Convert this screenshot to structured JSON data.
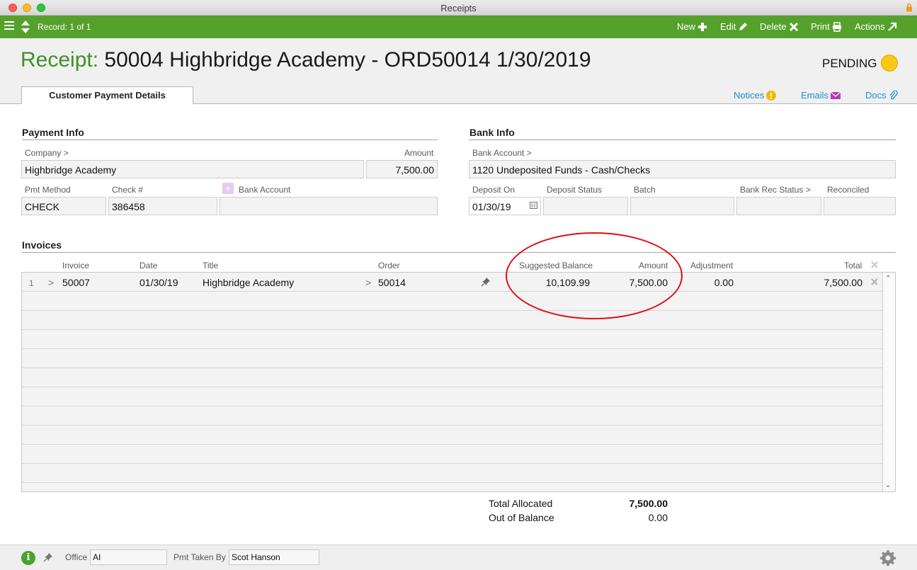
{
  "window": {
    "title": "Receipts"
  },
  "toolbar": {
    "record": "Record: 1 of 1",
    "new_label": "New",
    "edit_label": "Edit",
    "delete_label": "Delete",
    "print_label": "Print",
    "actions_label": "Actions"
  },
  "header": {
    "label": "Receipt:",
    "title": "50004 Highbridge Academy - ORD50014  1/30/2019",
    "status": "PENDING",
    "status_color": "#fbc813"
  },
  "tabs": [
    {
      "label": "Customer Payment Details"
    }
  ],
  "links": {
    "notices": "Notices",
    "emails": "Emails",
    "docs": "Docs"
  },
  "payment_info": {
    "heading": "Payment Info",
    "company_label": "Company >",
    "company": "Highbridge Academy",
    "amount_label": "Amount",
    "amount": "7,500.00",
    "pmt_method_label": "Pmt Method",
    "pmt_method": "CHECK",
    "check_label": "Check #",
    "check": "386458",
    "bank_account_label": "Bank Account",
    "bank_account": ""
  },
  "bank_info": {
    "heading": "Bank Info",
    "bank_account_label": "Bank Account >",
    "bank_account": "1120 Undeposited Funds - Cash/Checks",
    "deposit_on_label": "Deposit On",
    "deposit_on": "01/30/19",
    "deposit_status_label": "Deposit Status",
    "deposit_status": "",
    "batch_label": "Batch",
    "batch": "",
    "bank_rec_status_label": "Bank Rec Status >",
    "bank_rec_status": "",
    "reconciled_label": "Reconciled",
    "reconciled": ""
  },
  "invoices": {
    "heading": "Invoices",
    "columns": {
      "invoice": "Invoice",
      "date": "Date",
      "title": "Title",
      "order": "Order",
      "suggested_balance": "Suggested Balance",
      "amount": "Amount",
      "adjustment": "Adjustment",
      "total": "Total"
    },
    "rows": [
      {
        "num": "1",
        "invoice": "50007",
        "date": "01/30/19",
        "title": "Highbridge Academy",
        "order": "50014",
        "suggested_balance": "10,109.99",
        "amount": "7,500.00",
        "adjustment": "0.00",
        "total": "7,500.00"
      }
    ]
  },
  "totals": {
    "allocated_label": "Total Allocated",
    "allocated": "7,500.00",
    "out_of_balance_label": "Out of Balance",
    "out_of_balance": "0.00"
  },
  "footer": {
    "office_label": "Office",
    "office": "AI",
    "pmt_taken_by_label": "Pmt Taken By",
    "pmt_taken_by": "Scot Hanson"
  }
}
